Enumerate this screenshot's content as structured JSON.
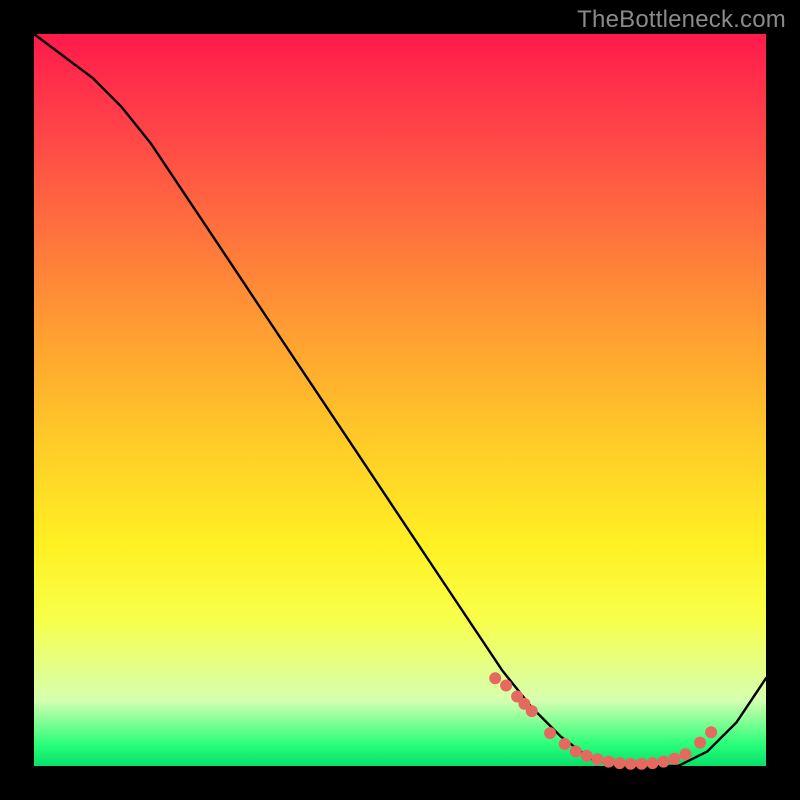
{
  "watermark": "TheBottleneck.com",
  "colors": {
    "background": "#000000",
    "curve": "#000000",
    "points": "#e46a60"
  },
  "chart_data": {
    "type": "line",
    "title": "",
    "xlabel": "",
    "ylabel": "",
    "xlim": [
      0,
      100
    ],
    "ylim": [
      0,
      100
    ],
    "grid": false,
    "legend": false,
    "series": [
      {
        "name": "curve",
        "x": [
          0,
          4,
          8,
          12,
          16,
          20,
          24,
          28,
          32,
          36,
          40,
          44,
          48,
          52,
          56,
          60,
          64,
          68,
          72,
          76,
          80,
          84,
          88,
          92,
          96,
          100
        ],
        "y": [
          100,
          97,
          94,
          90,
          85,
          79,
          73,
          67,
          61,
          55,
          49,
          43,
          37,
          31,
          25,
          19,
          13,
          8,
          4,
          1,
          0,
          0,
          0,
          2,
          6,
          12
        ]
      }
    ],
    "scatter_points": {
      "name": "markers",
      "x": [
        63,
        64.5,
        66,
        67,
        68,
        70.5,
        72.5,
        74,
        75.5,
        77,
        78.5,
        80,
        81.5,
        83,
        84.5,
        86,
        87.5,
        89,
        91,
        92.5
      ],
      "y": [
        12,
        11,
        9.5,
        8.5,
        7.5,
        4.5,
        3,
        2,
        1.4,
        0.9,
        0.6,
        0.4,
        0.3,
        0.3,
        0.4,
        0.6,
        1.0,
        1.6,
        3.2,
        4.6
      ]
    }
  }
}
